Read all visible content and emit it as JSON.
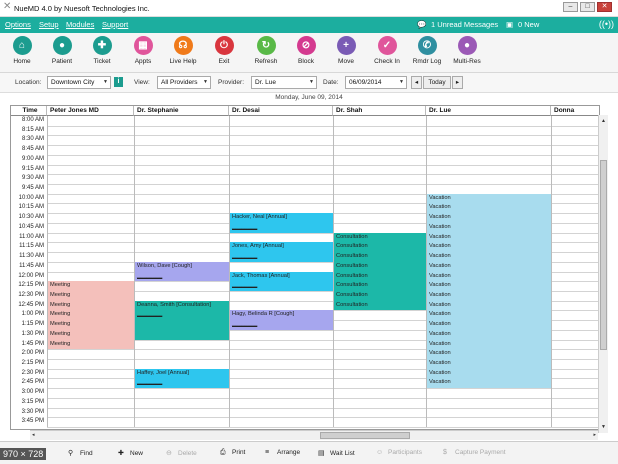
{
  "window": {
    "title": "NueMD 4.0 by Nuesoft Technologies Inc."
  },
  "menu": {
    "items": [
      "Options",
      "Setup",
      "Modules",
      "Support"
    ],
    "unread": "1 Unread Messages",
    "new": "0 New"
  },
  "toolbar": {
    "buttons": [
      {
        "label": "Home",
        "icon": "home-icon",
        "glyph": "⌂",
        "color": "#1c9c8f"
      },
      {
        "label": "Patient",
        "icon": "patient-icon",
        "glyph": "●",
        "color": "#1c9c8f"
      },
      {
        "label": "Ticket",
        "icon": "ticket-icon",
        "glyph": "✚",
        "color": "#1c9c8f"
      },
      {
        "label": "Appts",
        "icon": "calendar-icon",
        "glyph": "▦",
        "color": "#e0559b"
      },
      {
        "label": "Live Help",
        "icon": "headset-icon",
        "glyph": "☊",
        "color": "#f07a1a"
      },
      {
        "label": "Exit",
        "icon": "power-icon",
        "glyph": "⏻",
        "color": "#d9363e"
      },
      {
        "label": "Refresh",
        "icon": "refresh-icon",
        "glyph": "↻",
        "color": "#59b947"
      },
      {
        "label": "Block",
        "icon": "block-icon",
        "glyph": "⊘",
        "color": "#d43a8f"
      },
      {
        "label": "Move",
        "icon": "move-icon",
        "glyph": "+",
        "color": "#7a5bb5"
      },
      {
        "label": "Check In",
        "icon": "check-in-icon",
        "glyph": "✓",
        "color": "#e0559b"
      },
      {
        "label": "Rmdr Log",
        "icon": "phone-icon",
        "glyph": "✆",
        "color": "#2f8fa0"
      },
      {
        "label": "Multi-Res",
        "icon": "multi-res-icon",
        "glyph": "●",
        "color": "#9b59b6"
      }
    ]
  },
  "filters": {
    "location_label": "Location:",
    "location_value": "Downtown City",
    "view_label": "View:",
    "view_value": "All Providers",
    "provider_label": "Provider:",
    "provider_value": "Dr. Lue",
    "date_label": "Date:",
    "date_value": "06/09/2014",
    "today_label": "Today"
  },
  "schedule": {
    "date_caption": "Monday, June 09, 2014",
    "time_header": "Time",
    "columns": [
      "Peter Jones MD",
      "Dr. Stephanie",
      "Dr. Desai",
      "Dr. Shah",
      "Dr. Lue",
      "Donna"
    ],
    "times": [
      "8:00 AM",
      "8:15 AM",
      "8:30 AM",
      "8:45 AM",
      "9:00 AM",
      "9:15 AM",
      "9:30 AM",
      "9:45 AM",
      "10:00 AM",
      "10:15 AM",
      "10:30 AM",
      "10:45 AM",
      "11:00 AM",
      "11:15 AM",
      "11:30 AM",
      "11:45 AM",
      "12:00 PM",
      "12:15 PM",
      "12:30 PM",
      "12:45 PM",
      "1:00 PM",
      "1:15 PM",
      "1:30 PM",
      "1:45 PM",
      "2:00 PM",
      "2:15 PM",
      "2:30 PM",
      "2:45 PM",
      "3:00 PM",
      "3:15 PM",
      "3:30 PM",
      "3:45 PM"
    ],
    "appointments": [
      {
        "col": 0,
        "start": 17,
        "span": 1,
        "text": "Meeting",
        "sub": "",
        "color": "#f4c0bb"
      },
      {
        "col": 0,
        "start": 18,
        "span": 1,
        "text": "Meeting",
        "sub": "",
        "color": "#f4c0bb"
      },
      {
        "col": 0,
        "start": 19,
        "span": 1,
        "text": "Meeting",
        "sub": "",
        "color": "#f4c0bb"
      },
      {
        "col": 0,
        "start": 20,
        "span": 1,
        "text": "Meeting",
        "sub": "",
        "color": "#f4c0bb"
      },
      {
        "col": 0,
        "start": 21,
        "span": 1,
        "text": "Meeting",
        "sub": "",
        "color": "#f4c0bb"
      },
      {
        "col": 0,
        "start": 22,
        "span": 1,
        "text": "Meeting",
        "sub": "",
        "color": "#f4c0bb"
      },
      {
        "col": 0,
        "start": 23,
        "span": 1,
        "text": "Meeting",
        "sub": "",
        "color": "#f4c0bb"
      },
      {
        "col": 1,
        "start": 15,
        "span": 2,
        "text": "Wilson, Dave   [Cough]",
        "sub": "________",
        "color": "#a6a6ee"
      },
      {
        "col": 1,
        "start": 19,
        "span": 4,
        "text": "Deanna, Smith  [Consultation]",
        "sub": "________",
        "color": "#1cb8a8"
      },
      {
        "col": 1,
        "start": 26,
        "span": 2,
        "text": "Haffey, Joel   [Annual]",
        "sub": "________",
        "color": "#2ec6ee"
      },
      {
        "col": 2,
        "start": 10,
        "span": 2,
        "text": "Hacker, Neal   [Annual]",
        "sub": "________",
        "color": "#2ec6ee"
      },
      {
        "col": 2,
        "start": 13,
        "span": 2,
        "text": "Jones, Amy   [Annual]",
        "sub": "________",
        "color": "#2ec6ee"
      },
      {
        "col": 2,
        "start": 16,
        "span": 2,
        "text": "Jack, Thomas   [Annual]",
        "sub": "________",
        "color": "#2ec6ee"
      },
      {
        "col": 2,
        "start": 20,
        "span": 2,
        "text": "Hagy, Belinda R   [Cough]",
        "sub": "________",
        "color": "#a6a6ee"
      },
      {
        "col": 3,
        "start": 12,
        "span": 1,
        "text": "Consultation",
        "sub": "",
        "color": "#1cb8a8"
      },
      {
        "col": 3,
        "start": 13,
        "span": 1,
        "text": "Consultation",
        "sub": "",
        "color": "#1cb8a8"
      },
      {
        "col": 3,
        "start": 14,
        "span": 1,
        "text": "Consultation",
        "sub": "",
        "color": "#1cb8a8"
      },
      {
        "col": 3,
        "start": 15,
        "span": 1,
        "text": "Consultation",
        "sub": "",
        "color": "#1cb8a8"
      },
      {
        "col": 3,
        "start": 16,
        "span": 1,
        "text": "Consultation",
        "sub": "",
        "color": "#1cb8a8"
      },
      {
        "col": 3,
        "start": 17,
        "span": 1,
        "text": "Consultation",
        "sub": "",
        "color": "#1cb8a8"
      },
      {
        "col": 3,
        "start": 18,
        "span": 1,
        "text": "Consultation",
        "sub": "",
        "color": "#1cb8a8"
      },
      {
        "col": 3,
        "start": 19,
        "span": 1,
        "text": "Consultation",
        "sub": "",
        "color": "#1cb8a8"
      },
      {
        "col": 4,
        "start": 8,
        "span": 1,
        "text": "Vacation",
        "sub": "",
        "color": "#a8dcee"
      },
      {
        "col": 4,
        "start": 9,
        "span": 1,
        "text": "Vacation",
        "sub": "",
        "color": "#a8dcee"
      },
      {
        "col": 4,
        "start": 10,
        "span": 1,
        "text": "Vacation",
        "sub": "",
        "color": "#a8dcee"
      },
      {
        "col": 4,
        "start": 11,
        "span": 1,
        "text": "Vacation",
        "sub": "",
        "color": "#a8dcee"
      },
      {
        "col": 4,
        "start": 12,
        "span": 1,
        "text": "Vacation",
        "sub": "",
        "color": "#a8dcee"
      },
      {
        "col": 4,
        "start": 13,
        "span": 1,
        "text": "Vacation",
        "sub": "",
        "color": "#a8dcee"
      },
      {
        "col": 4,
        "start": 14,
        "span": 1,
        "text": "Vacation",
        "sub": "",
        "color": "#a8dcee"
      },
      {
        "col": 4,
        "start": 15,
        "span": 1,
        "text": "Vacation",
        "sub": "",
        "color": "#a8dcee"
      },
      {
        "col": 4,
        "start": 16,
        "span": 1,
        "text": "Vacation",
        "sub": "",
        "color": "#a8dcee"
      },
      {
        "col": 4,
        "start": 17,
        "span": 1,
        "text": "Vacation",
        "sub": "",
        "color": "#a8dcee"
      },
      {
        "col": 4,
        "start": 18,
        "span": 1,
        "text": "Vacation",
        "sub": "",
        "color": "#a8dcee"
      },
      {
        "col": 4,
        "start": 19,
        "span": 1,
        "text": "Vacation",
        "sub": "",
        "color": "#a8dcee"
      },
      {
        "col": 4,
        "start": 20,
        "span": 1,
        "text": "Vacation",
        "sub": "",
        "color": "#a8dcee"
      },
      {
        "col": 4,
        "start": 21,
        "span": 1,
        "text": "Vacation",
        "sub": "",
        "color": "#a8dcee"
      },
      {
        "col": 4,
        "start": 22,
        "span": 1,
        "text": "Vacation",
        "sub": "",
        "color": "#a8dcee"
      },
      {
        "col": 4,
        "start": 23,
        "span": 1,
        "text": "Vacation",
        "sub": "",
        "color": "#a8dcee"
      },
      {
        "col": 4,
        "start": 24,
        "span": 1,
        "text": "Vacation",
        "sub": "",
        "color": "#a8dcee"
      },
      {
        "col": 4,
        "start": 25,
        "span": 1,
        "text": "Vacation",
        "sub": "",
        "color": "#a8dcee"
      },
      {
        "col": 4,
        "start": 26,
        "span": 1,
        "text": "Vacation",
        "sub": "",
        "color": "#a8dcee"
      },
      {
        "col": 4,
        "start": 27,
        "span": 1,
        "text": "Vacation",
        "sub": "",
        "color": "#a8dcee"
      }
    ]
  },
  "bottombar": {
    "items": [
      {
        "label": "Find",
        "icon": "find-icon",
        "glyph": "⚲",
        "enabled": true
      },
      {
        "label": "New",
        "icon": "new-icon",
        "glyph": "✚",
        "enabled": true
      },
      {
        "label": "Delete",
        "icon": "delete-icon",
        "glyph": "⊖",
        "enabled": false
      },
      {
        "label": "Print",
        "icon": "print-icon",
        "glyph": "⎙",
        "enabled": true
      },
      {
        "label": "Arrange",
        "icon": "arrange-icon",
        "glyph": "≡",
        "enabled": true
      },
      {
        "label": "Wait List",
        "icon": "wait-list-icon",
        "glyph": "▤",
        "enabled": true
      },
      {
        "label": "Participants",
        "icon": "participants-icon",
        "glyph": "☺",
        "enabled": false
      },
      {
        "label": "Capture Payment",
        "icon": "payment-icon",
        "glyph": "$",
        "enabled": false
      }
    ]
  },
  "overlay": {
    "dimensions": "970 × 728"
  }
}
